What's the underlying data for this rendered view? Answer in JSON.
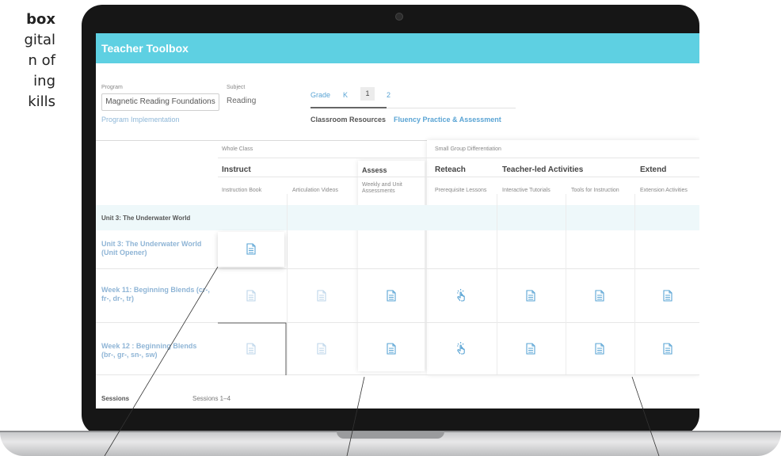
{
  "side_text": [
    "box",
    "gital",
    "n of",
    "ing",
    "kills"
  ],
  "app": {
    "title": "Teacher Toolbox"
  },
  "filters": {
    "program_label": "Program",
    "program_value": "Magnetic Reading Foundations",
    "subject_label": "Subject",
    "subject_value": "Reading",
    "program_link": "Program Implementation",
    "grade_label": "Grade",
    "grades": [
      "K",
      "1",
      "2"
    ],
    "selected_grade": "1",
    "tabs": [
      "Classroom Resources",
      "Fluency Practice & Assessment"
    ]
  },
  "table": {
    "group_whole": "Whole Class",
    "group_small": "Small Group Differentiation",
    "col_instruct": "Instruct",
    "col_assess": "Assess",
    "col_reteach": "Reteach",
    "col_teacher": "Teacher-led Activities",
    "col_extend": "Extend",
    "sub_instruction_book": "Instruction Book",
    "sub_articulation": "Articulation Videos",
    "sub_weekly_unit": "Weekly and Unit Assessments",
    "sub_prereq": "Prerequisite Lessons",
    "sub_interactive": "Interactive Tutorials",
    "sub_tools": "Tools for Instruction",
    "sub_extension": "Extension Activities",
    "unit_header": "Unit 3: The Underwater World",
    "rows": [
      "Unit 3: The Underwater World (Unit Opener)",
      "Week 11: Beginning Blends (cr-, fr-, dr-, tr)",
      "Week 12 : Beginning Blends (br-, gr-, sn-, sw)"
    ],
    "sessions_label": "Sessions",
    "sessions_value": "Sessions 1–4"
  },
  "colors": {
    "header": "#5ed0e2",
    "link": "#5aa4d4",
    "row_label": "#8fb5d6"
  },
  "icons": [
    "document-icon",
    "tap-hand-icon",
    "camera-icon"
  ]
}
